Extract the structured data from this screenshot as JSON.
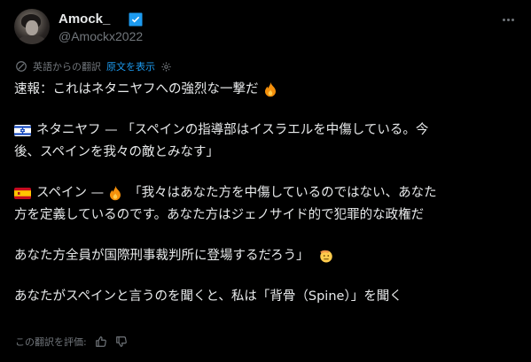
{
  "author": {
    "display_name": "Amock_",
    "handle": "@Amockx2022",
    "verified_color": "#1d9bf0"
  },
  "translation": {
    "source_label": "英語からの翻訳",
    "show_original_label": "原文を表示",
    "link_color": "#1d9bf0"
  },
  "tweet": {
    "line1": "速報：これはネタニヤフへの強烈な一撃だ",
    "netanyahu_label": "ネタニヤフ — 「スペインの指導部はイスラエルを中傷している。今",
    "netanyahu_cont": "後、スペインを我々の敵とみなす」",
    "spain_label": "スペイン —",
    "spain_quote": "「我々はあなた方を中傷しているのではない、あなた",
    "spain_cont": "方を定義しているのです。あなた方はジェノサイド的で犯罪的な政権だ",
    "icc_line": "あなた方全員が国際刑事裁判所に登場するだろう」",
    "spine_line": "あなたがスペインと言うのを聞くと、私は「背骨（Spine）」を聞く"
  },
  "rating": {
    "label": "この翻訳を評価:"
  },
  "icons": {
    "verified": "verified-badge-icon",
    "more": "more-options-icon",
    "translate": "translate-globe-icon",
    "settings": "gear-icon",
    "fire": "fire-emoji-icon",
    "israel_flag": "israel-flag-icon",
    "spain_flag": "spain-flag-icon",
    "salute": "saluting-face-emoji-icon",
    "thumbs_up": "thumbs-up-icon",
    "thumbs_down": "thumbs-down-icon"
  }
}
